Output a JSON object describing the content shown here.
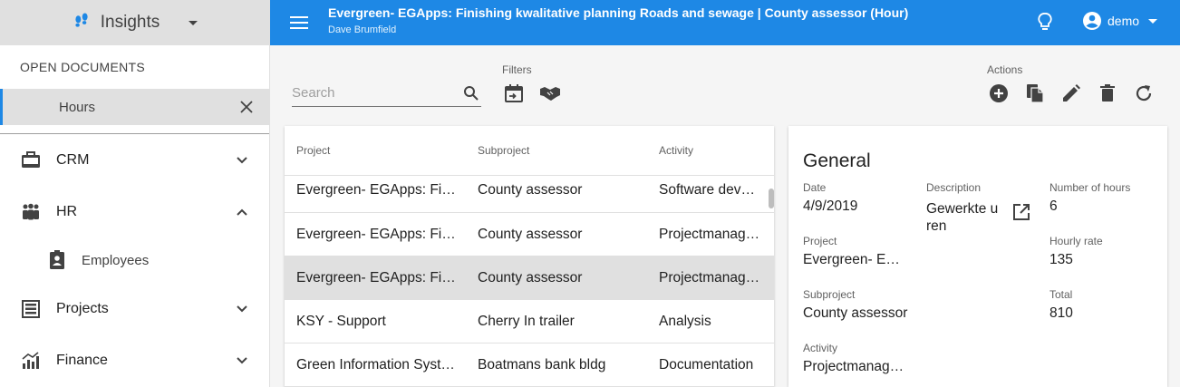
{
  "sidebar": {
    "app_title": "Insights",
    "open_documents_label": "OPEN DOCUMENTS",
    "open_documents": [
      {
        "label": "Hours"
      }
    ],
    "nav": [
      {
        "label": "CRM",
        "icon": "briefcase-icon",
        "expanded": false
      },
      {
        "label": "HR",
        "icon": "people-icon",
        "expanded": true
      },
      {
        "label": "Employees",
        "icon": "badge-icon",
        "sub": true
      },
      {
        "label": "Projects",
        "icon": "projects-icon",
        "expanded": false
      },
      {
        "label": "Finance",
        "icon": "finance-chart-icon",
        "expanded": false
      }
    ]
  },
  "topbar": {
    "title": "Evergreen- EGApps: Finishing kwalitative planning Roads and sewage | County assessor (Hour)",
    "subtitle": "Dave Brumfield",
    "user": "demo"
  },
  "toolbar": {
    "search_placeholder": "Search",
    "filters_label": "Filters",
    "actions_label": "Actions"
  },
  "table": {
    "headers": [
      "Project",
      "Subproject",
      "Activity"
    ],
    "rows": [
      {
        "project": "Evergreen- EGApps: Finishing kwalitative planning Roads and sewage",
        "subproject": "County assessor",
        "activity": "Software development",
        "selected": false
      },
      {
        "project": "Evergreen- EGApps: Finishing kwalitative planning Roads and sewage",
        "subproject": "County assessor",
        "activity": "Projectmanagement",
        "selected": false
      },
      {
        "project": "Evergreen- EGApps: Finishing kwalitative planning Roads and sewage",
        "subproject": "County assessor",
        "activity": "Projectmanagement",
        "selected": true
      },
      {
        "project": "KSY - Support",
        "subproject": "Cherry In trailer",
        "activity": "Analysis",
        "selected": false
      },
      {
        "project": "Green Information Systems",
        "subproject": "Boatmans bank bldg",
        "activity": "Documentation",
        "selected": false
      }
    ]
  },
  "detail": {
    "title": "General",
    "date_label": "Date",
    "date": "4/9/2019",
    "description_label": "Description",
    "description": "Gewerkte uren",
    "hours_label": "Number of hours",
    "hours": "6",
    "project_label": "Project",
    "project": "Evergreen- EGApps: Finishing kwalitative planning Roads and sewage",
    "rate_label": "Hourly rate",
    "rate": "135",
    "subproject_label": "Subproject",
    "subproject": "County assessor",
    "total_label": "Total",
    "total": "810",
    "activity_label": "Activity",
    "activity": "Projectmanagement"
  },
  "colors": {
    "primary": "#1e88e5",
    "selected_row": "#e0e0e0",
    "sidebar_header": "#e0e0e0"
  }
}
